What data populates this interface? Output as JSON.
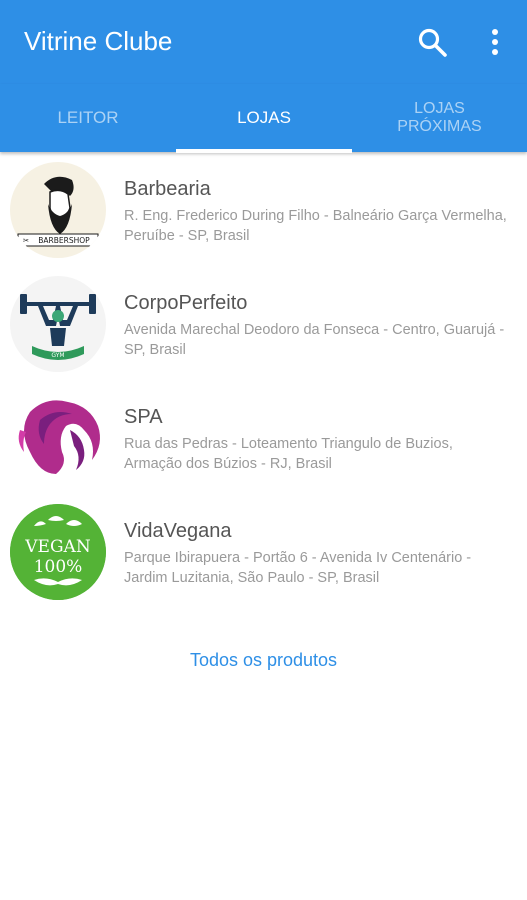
{
  "appbar": {
    "title": "Vitrine Clube",
    "search_icon": "search-icon",
    "menu_icon": "more-vert-icon"
  },
  "tabs": [
    {
      "label": "LEITOR",
      "active": false
    },
    {
      "label": "LOJAS",
      "active": true
    },
    {
      "label": "LOJAS PRÓXIMAS",
      "active": false
    }
  ],
  "stores": [
    {
      "name": "Barbearia",
      "address": "R. Eng. Frederico During Filho - Balneário Garça Vermelha, Peruíbe - SP, Brasil",
      "logo": "barbershop-logo",
      "logo_text": "BARBERSHOP"
    },
    {
      "name": "CorpoPerfeito",
      "address": "Avenida Marechal Deodoro da Fonseca - Centro, Guarujá - SP, Brasil",
      "logo": "gym-logo",
      "logo_text": "GYM"
    },
    {
      "name": "SPA",
      "address": "Rua das Pedras - Loteamento Triangulo de Buzios, Armação dos Búzios - RJ, Brasil",
      "logo": "spa-woman-logo"
    },
    {
      "name": "VidaVegana",
      "address": "Parque Ibirapuera - Portão 6 - Avenida Iv Centenário - Jardim Luzitania, São Paulo - SP, Brasil",
      "logo": "vegan-logo",
      "logo_text_top": "VEGAN",
      "logo_text_bottom": "100%"
    }
  ],
  "footer_link": "Todos os produtos",
  "colors": {
    "primary": "#2e8fe6",
    "title_text": "#555555",
    "address_text": "#9a9a9a"
  }
}
